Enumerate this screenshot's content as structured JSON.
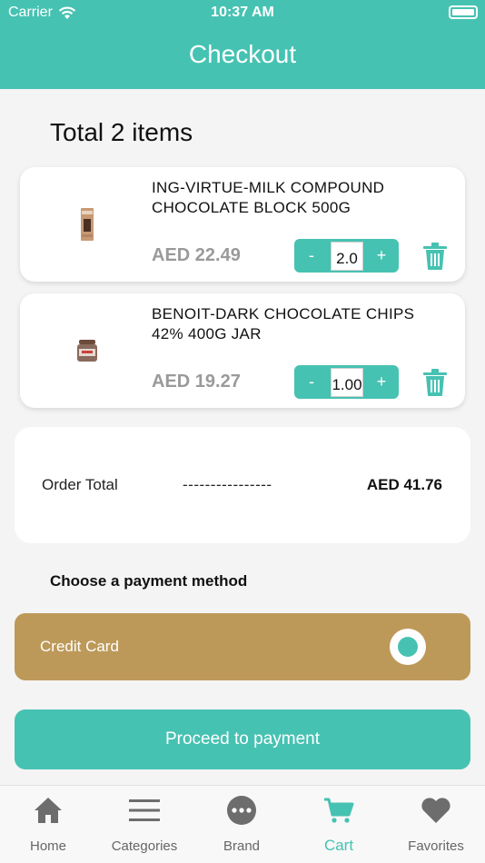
{
  "status_bar": {
    "carrier": "Carrier",
    "time": "10:37 AM"
  },
  "header": {
    "title": "Checkout"
  },
  "cart": {
    "total_label": "Total 2 items",
    "items": [
      {
        "name": "ING-VIRTUE-MILK COMPOUND CHOCOLATE BLOCK 500G",
        "price": "AED 22.49",
        "quantity": "2.0",
        "minus": "-",
        "plus": "+"
      },
      {
        "name": "BENOIT-DARK CHOCOLATE CHIPS 42% 400G JAR",
        "price": "AED 19.27",
        "quantity": "1.00",
        "minus": "-",
        "plus": "+"
      }
    ]
  },
  "order_total": {
    "label": "Order Total",
    "dashes": "----------------",
    "value": "AED 41.76"
  },
  "payment": {
    "heading": "Choose a payment method",
    "option_label": "Credit Card",
    "selected": true
  },
  "proceed_label": "Proceed to payment",
  "tabs": [
    {
      "label": "Home",
      "icon": "home-icon"
    },
    {
      "label": "Categories",
      "icon": "menu-icon"
    },
    {
      "label": "Brand",
      "icon": "more-icon"
    },
    {
      "label": "Cart",
      "icon": "cart-icon",
      "active": true
    },
    {
      "label": "Favorites",
      "icon": "heart-icon"
    }
  ],
  "colors": {
    "accent": "#46c2b2",
    "payment_option": "#bd9959",
    "price": "#9a9a9a",
    "tab_inactive": "#666666"
  }
}
